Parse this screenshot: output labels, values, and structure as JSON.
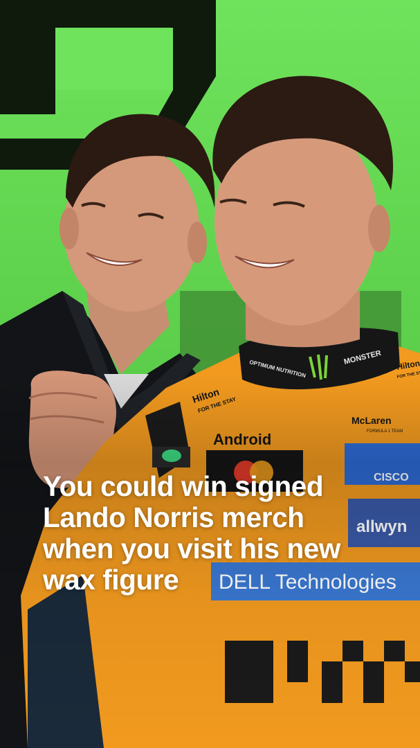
{
  "story": {
    "headline_lines": [
      "You could win signed",
      "Lando Norris merch",
      "when you visit his new",
      "wax figure"
    ],
    "photo_description_icon": "photo-two-drivers-smiling"
  },
  "suit_logos": {
    "hilton_line1": "Hilton",
    "hilton_line2": "FOR THE STAY",
    "android": "Android",
    "mclaren": "McLaren",
    "mclaren_sub": "FORMULA 1 TEAM",
    "cisco": "CISCO",
    "allwyn": "allwyn",
    "dell": "DELL Technologies",
    "monster": "MONSTER",
    "optimum": "OPTIMUM NUTRITION",
    "hilton_small": "Hilton",
    "hilton_small_sub": "FOR THE STAY"
  },
  "colors": {
    "background_green": "#6fe35c",
    "papaya_orange": "#f29a1f",
    "headline_text": "#ffffff"
  }
}
